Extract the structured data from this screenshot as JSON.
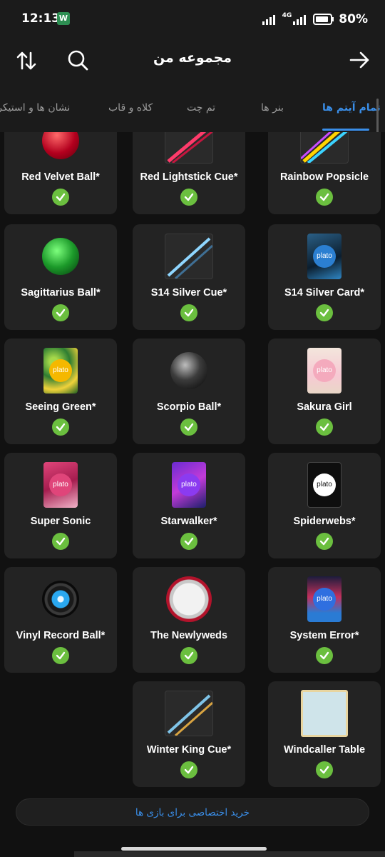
{
  "status_bar": {
    "time": "12:13",
    "notification_icon": "app-notification-icon",
    "network_label": "4G",
    "battery": "80%"
  },
  "header": {
    "title": "مجموعه من",
    "sort_icon": "sort-arrows-icon",
    "search_icon": "search-icon",
    "back_icon": "arrow-right-icon"
  },
  "tabs": [
    {
      "label": "تمام آیتم ها",
      "active": true
    },
    {
      "label": "بنر ها",
      "active": false
    },
    {
      "label": "تم چت",
      "active": false
    },
    {
      "label": "کلاه و قاب",
      "active": false
    },
    {
      "label": "نشان ها و استیکر ها",
      "active": false
    }
  ],
  "items": [
    {
      "name": "Red Velvet Ball*",
      "icon": "red-velvet-ball-icon",
      "owned": true
    },
    {
      "name": "Red Lightstick Cue*",
      "icon": "red-lightstick-cue-icon",
      "owned": true
    },
    {
      "name": "Rainbow Popsicle",
      "icon": "rainbow-popsicle-icon",
      "owned": true
    },
    {
      "name": "Sagittarius Ball*",
      "icon": "sagittarius-ball-icon",
      "owned": true
    },
    {
      "name": "S14 Silver Cue*",
      "icon": "s14-silver-cue-icon",
      "owned": true
    },
    {
      "name": "S14 Silver Card*",
      "icon": "s14-silver-card-icon",
      "owned": true
    },
    {
      "name": "Seeing Green*",
      "icon": "seeing-green-card-icon",
      "owned": true
    },
    {
      "name": "Scorpio Ball*",
      "icon": "scorpio-ball-icon",
      "owned": true
    },
    {
      "name": "Sakura Girl",
      "icon": "sakura-girl-card-icon",
      "owned": true
    },
    {
      "name": "Super Sonic",
      "icon": "super-sonic-card-icon",
      "owned": true
    },
    {
      "name": "Starwalker*",
      "icon": "starwalker-card-icon",
      "owned": true
    },
    {
      "name": "Spiderwebs*",
      "icon": "spiderwebs-card-icon",
      "owned": true
    },
    {
      "name": "Vinyl Record Ball*",
      "icon": "vinyl-record-ball-icon",
      "owned": true
    },
    {
      "name": "The Newlyweds",
      "icon": "newlyweds-frame-icon",
      "owned": true
    },
    {
      "name": "System Error*",
      "icon": "system-error-card-icon",
      "owned": true
    },
    {
      "name": "Winter King Cue*",
      "icon": "winter-king-cue-icon",
      "owned": true
    },
    {
      "name": "Windcaller Table",
      "icon": "windcaller-table-icon",
      "owned": true
    }
  ],
  "plato_text": "plato",
  "buy_button": "خرید اختصاصی برای بازی ها",
  "colors": {
    "accent": "#3a8ee8",
    "check": "#6bbf3f",
    "card_bg": "#232323",
    "header_bg": "#1b1b1b"
  }
}
